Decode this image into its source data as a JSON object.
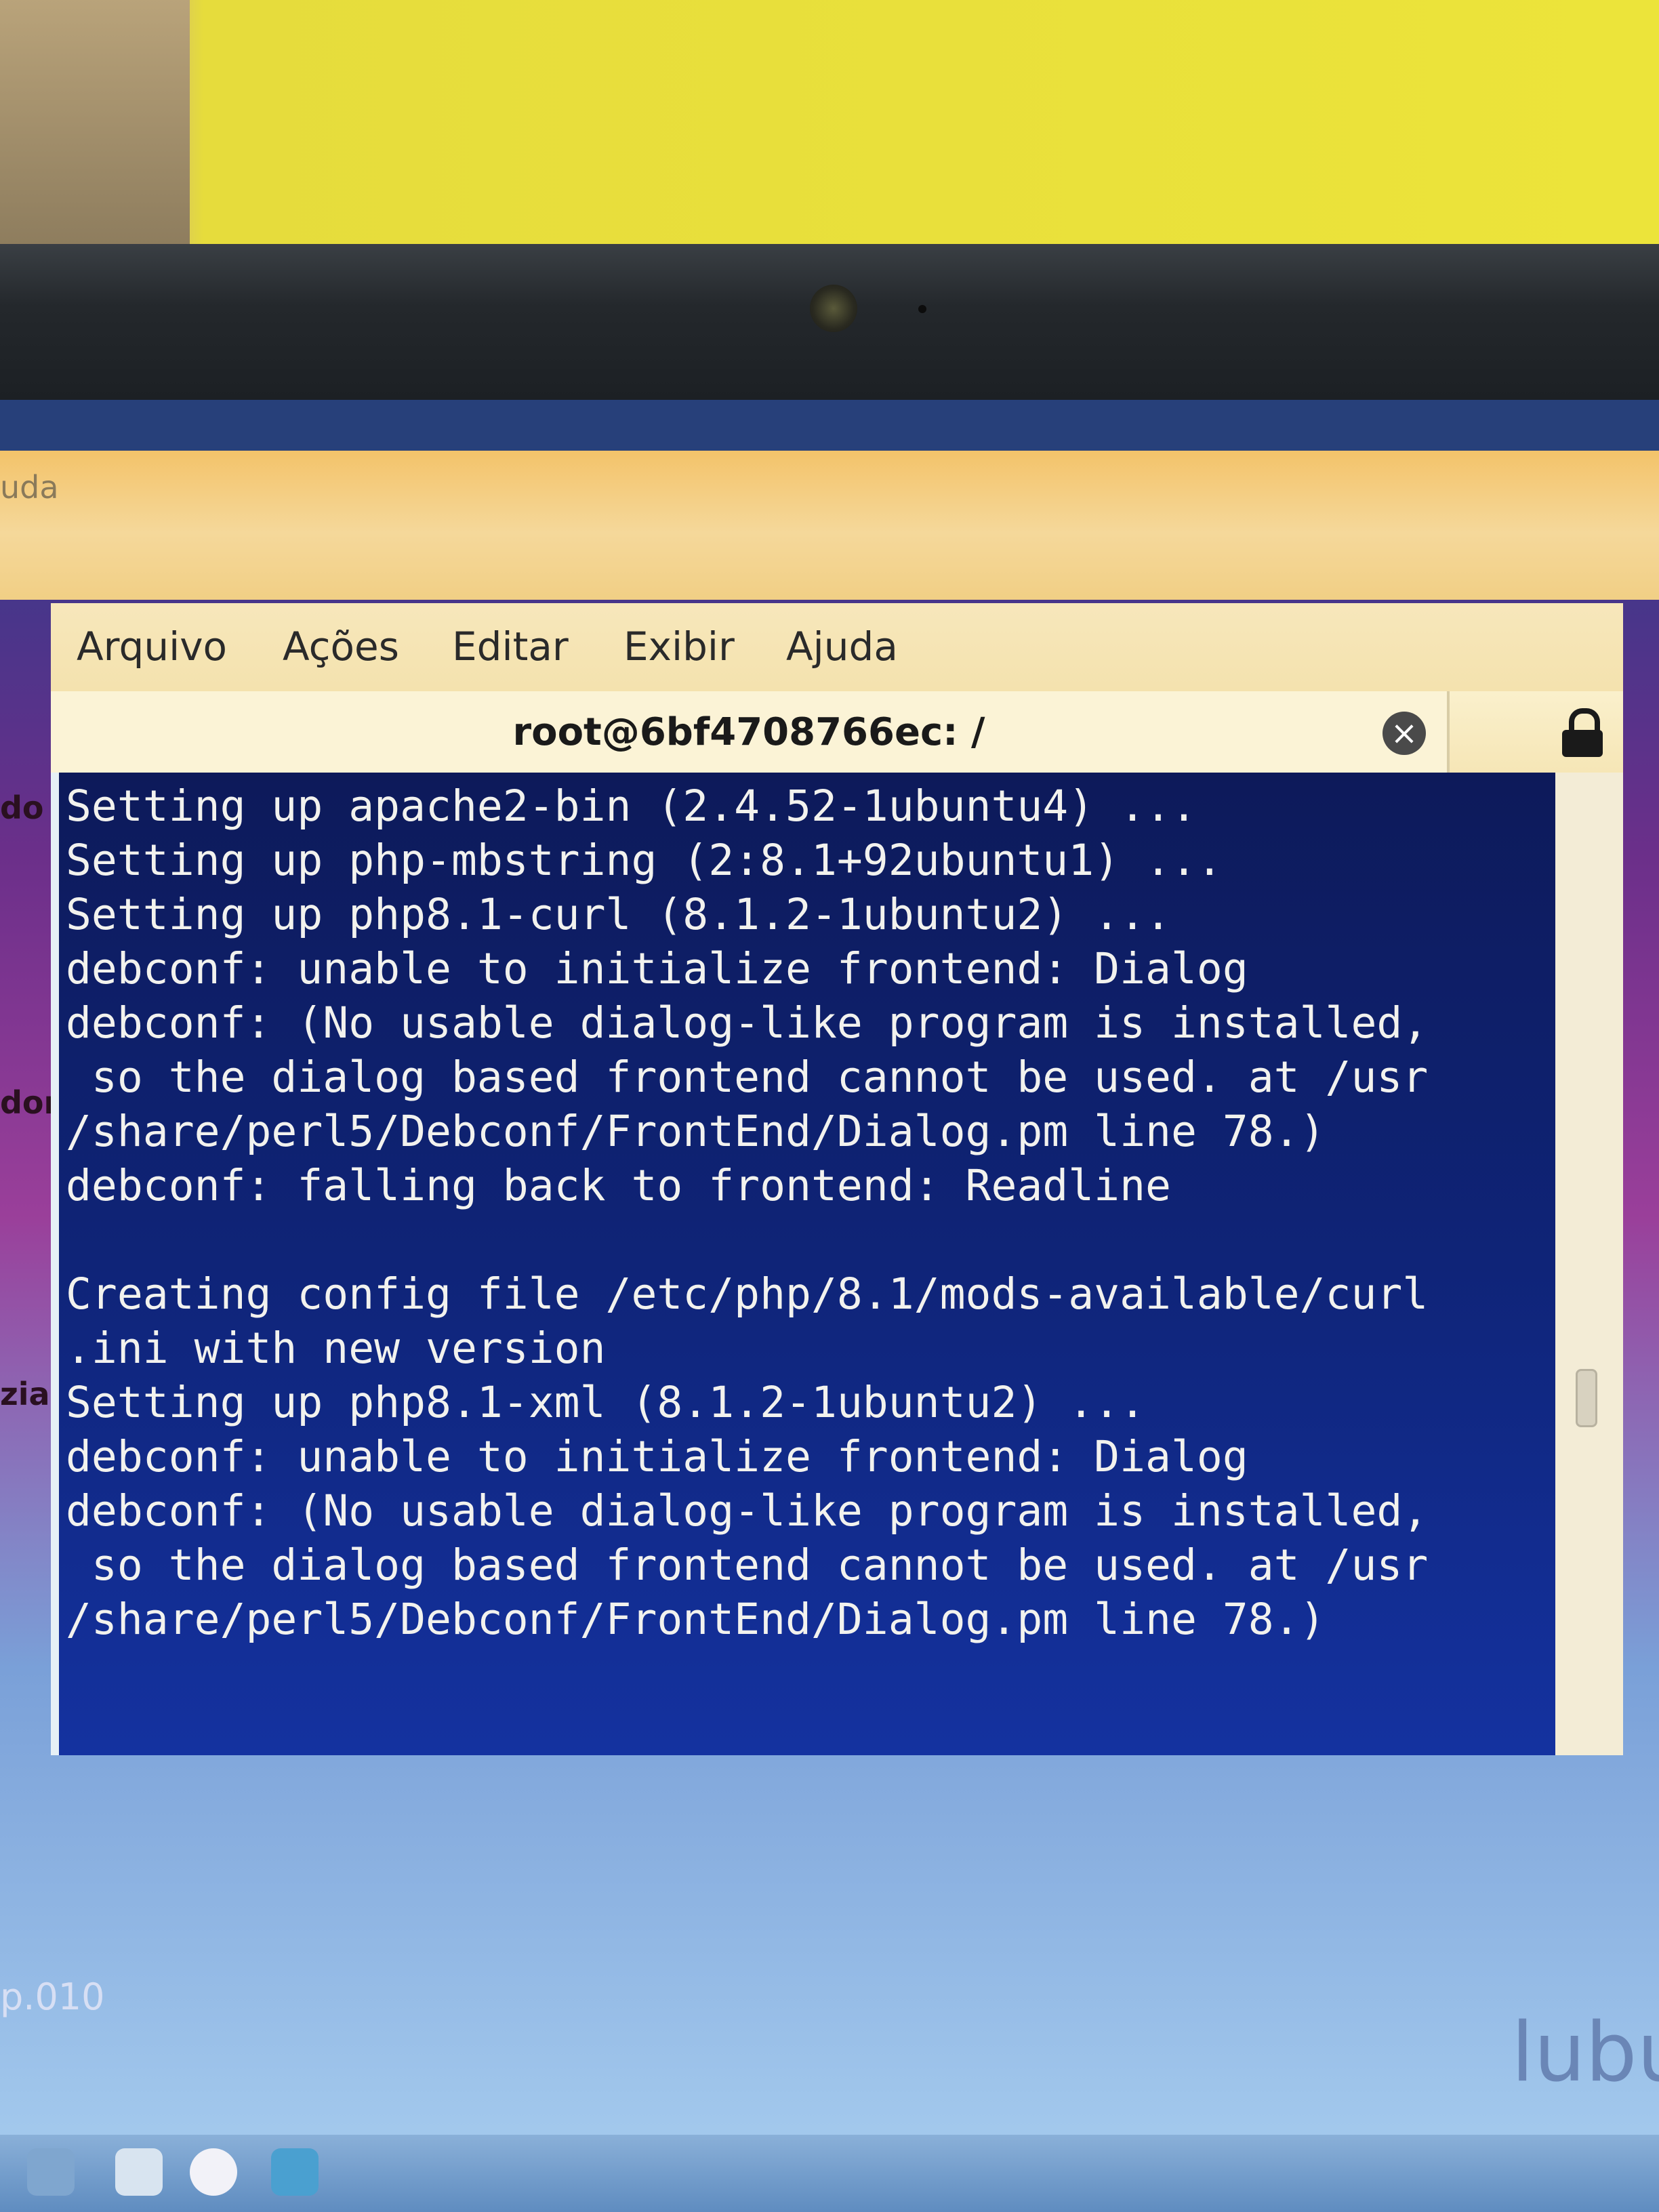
{
  "background_window": {
    "title_fragment": "uda",
    "side_labels": [
      "do",
      "dor",
      "zia)"
    ]
  },
  "terminal": {
    "menu": [
      "Arquivo",
      "Ações",
      "Editar",
      "Exibir",
      "Ajuda"
    ],
    "tab_title": "root@6bf4708766ec: /",
    "lines": [
      "Setting up apache2-bin (2.4.52-1ubuntu4) ...",
      "Setting up php-mbstring (2:8.1+92ubuntu1) ...",
      "Setting up php8.1-curl (8.1.2-1ubuntu2) ...",
      "debconf: unable to initialize frontend: Dialog",
      "debconf: (No usable dialog-like program is installed,",
      " so the dialog based frontend cannot be used. at /usr",
      "/share/perl5/Debconf/FrontEnd/Dialog.pm line 78.)",
      "debconf: falling back to frontend: Readline",
      "",
      "Creating config file /etc/php/8.1/mods-available/curl",
      ".ini with new version",
      "Setting up php8.1-xml (8.1.2-1ubuntu2) ...",
      "debconf: unable to initialize frontend: Dialog",
      "debconf: (No usable dialog-like program is installed,",
      " so the dialog based frontend cannot be used. at /usr",
      "/share/perl5/Debconf/FrontEnd/Dialog.pm line 78.)"
    ]
  },
  "desktop": {
    "version_text": "p.010",
    "brand_fragment": "lubu"
  }
}
